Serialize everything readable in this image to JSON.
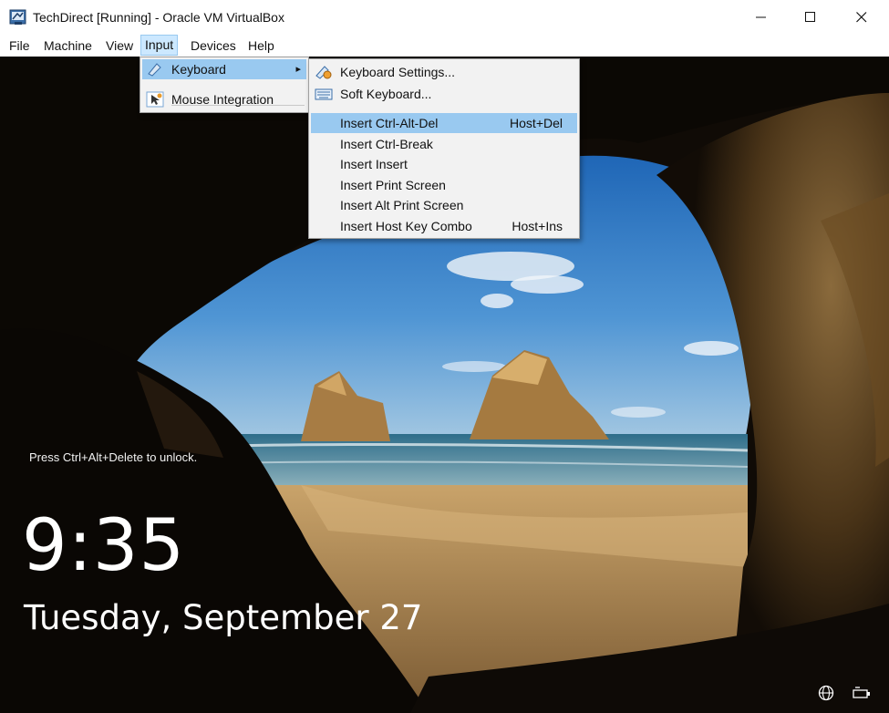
{
  "window": {
    "title": "TechDirect [Running] - Oracle VM VirtualBox"
  },
  "menubar": {
    "items": [
      "File",
      "Machine",
      "View",
      "Input",
      "Devices",
      "Help"
    ]
  },
  "input_menu": {
    "items": [
      {
        "label": "Keyboard",
        "icon": "keyboard-icon",
        "submenu_arrow": "▸"
      },
      {
        "label": "Mouse Integration",
        "icon": "mouse-integration-icon"
      }
    ]
  },
  "keyboard_menu": {
    "items": [
      {
        "label": "Keyboard Settings...",
        "icon": "keyboard-settings-icon",
        "shortcut": ""
      },
      {
        "label": "Soft Keyboard...",
        "icon": "soft-keyboard-icon",
        "shortcut": ""
      },
      {
        "label": "Insert Ctrl-Alt-Del",
        "shortcut": "Host+Del"
      },
      {
        "label": "Insert Ctrl-Break",
        "shortcut": ""
      },
      {
        "label": "Insert Insert",
        "shortcut": ""
      },
      {
        "label": "Insert Print Screen",
        "shortcut": ""
      },
      {
        "label": "Insert Alt Print Screen",
        "shortcut": ""
      },
      {
        "label": "Insert Host Key Combo",
        "shortcut": "Host+Ins"
      }
    ]
  },
  "lockscreen": {
    "unlock_hint": "Press Ctrl+Alt+Delete to unlock.",
    "time": "9:35",
    "date": "Tuesday, September 27"
  },
  "annotation": {
    "arrow_color": "#e8141b"
  }
}
